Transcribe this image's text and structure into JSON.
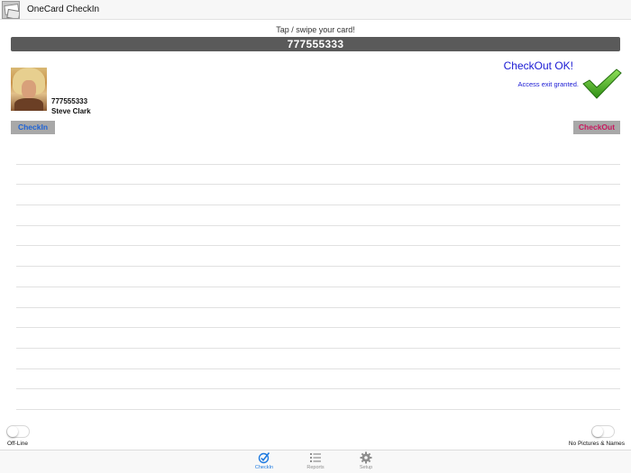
{
  "header": {
    "title": "OneCard CheckIn",
    "icon": "app-logo-icon"
  },
  "prompt": "Tap / swipe your card!",
  "card_number": "777555333",
  "person": {
    "id": "777555333",
    "name": "Steve Clark"
  },
  "status": {
    "title": "CheckOut OK!",
    "message": "Access exit granted.",
    "icon": "checkmark-icon",
    "color": "#1a1ad4"
  },
  "buttons": {
    "checkin": "CheckIn",
    "checkout": "CheckOut"
  },
  "toggles": {
    "offline": {
      "label": "Off-Line",
      "on": false
    },
    "no_pictures": {
      "label": "No Pictures & Names",
      "on": false
    }
  },
  "tabs": [
    {
      "label": "CheckIn",
      "icon": "checkin-icon",
      "active": true
    },
    {
      "label": "Reports",
      "icon": "list-icon",
      "active": false
    },
    {
      "label": "Setup",
      "icon": "gear-icon",
      "active": false
    }
  ],
  "colors": {
    "accent": "#1e7ae0",
    "checkout": "#c8175e",
    "check_green": "#3aa51c"
  }
}
